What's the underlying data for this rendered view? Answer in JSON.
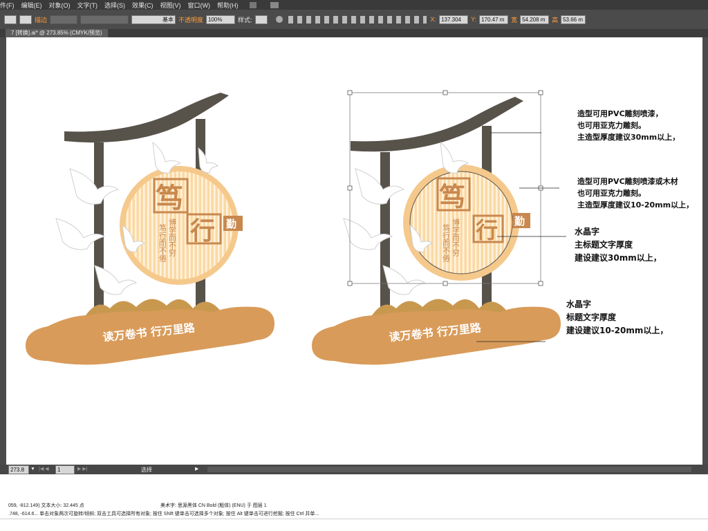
{
  "menubar": {
    "items": [
      "件(F)",
      "编辑(E)",
      "对象(O)",
      "文字(T)",
      "选择(S)",
      "效果(C)",
      "视图(V)",
      "窗口(W)",
      "帮助(H)"
    ]
  },
  "toolbar": {
    "stroke_label": "描边",
    "brush_label": "基本",
    "opacity_label": "不透明度",
    "opacity_value": "100%",
    "style_label": "样式:",
    "x_value": "137.304",
    "y_value": "170.47 m",
    "w_label": "宽",
    "w_value": "54.208 m",
    "h_label": "高",
    "h_value": "53.66 m"
  },
  "document_tab": "7 [转换].ai* @ 273.85% (CMYK/预览)",
  "statusbar": {
    "zoom": "273.8",
    "page": "1",
    "mode": "选择"
  },
  "bottom_panel": {
    "line1_a": "059, -812.149)  文本大小: 32.445 点",
    "line1_b": "美术字: 思源黑体 CN Bold (粗体) (ENU) 于 图层 1",
    "line2": ".748, -614.6...  单击对象两次可旋转/倾斜; 双击工具可选择所有对象; 按住 Shift 键单击可选择多个对象; 按住 Alt 键单击可进行挖掘; 按住 Ctrl 并单..."
  },
  "design": {
    "big_char_1": "笃",
    "big_char_2": "行",
    "side_char": "勤",
    "vertical_line_1": "博学而不穷",
    "vertical_line_2": "笃行而不倦",
    "base_text": "读万卷书 行万里路"
  },
  "annotations": {
    "a1": [
      "造型可用PVC雕刻喷漆，",
      "也可用亚克力雕刻。",
      "主造型厚度建议30mm以上，"
    ],
    "a2": [
      "造型可用PVC雕刻喷漆或木材",
      "也可用亚克力雕刻。",
      "主造型厚度建议10-20mm以上，"
    ],
    "a3": [
      "水晶字",
      "主标题文字厚度",
      "建设建议30mm以上，"
    ],
    "a4": [
      "水晶字",
      "标题文字厚度",
      "建设建议10-20mm以上，"
    ]
  },
  "colors": {
    "roof": "#57524a",
    "circle_fill": "#fbd9a4",
    "circle_ring": "#f5c98c",
    "text_brown": "#c8884e",
    "base": "#d99b5a",
    "hills": "#c9984f"
  }
}
